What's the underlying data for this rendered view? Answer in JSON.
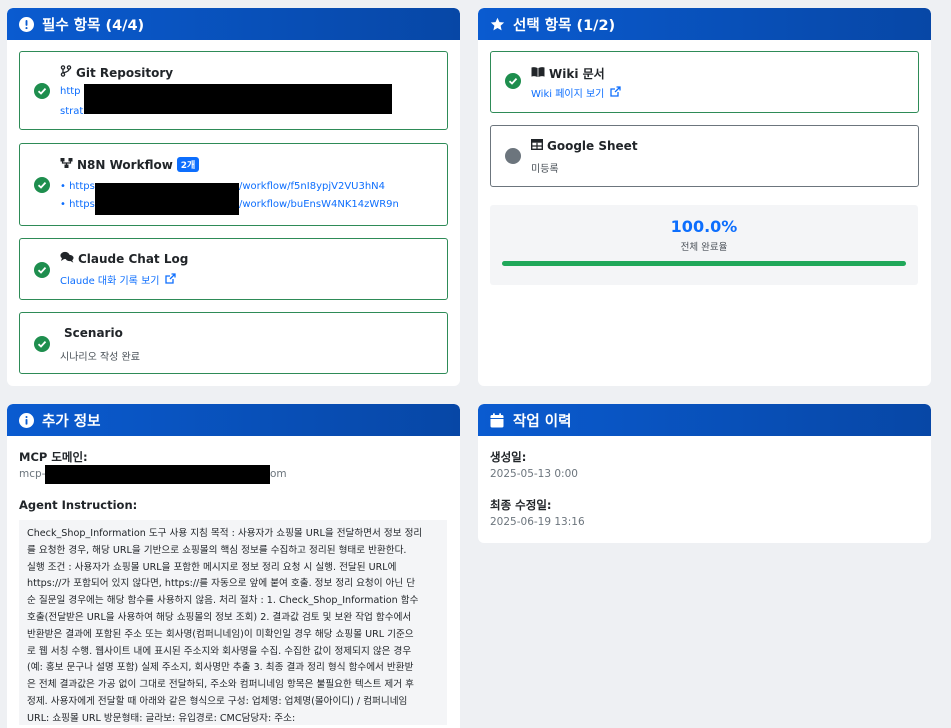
{
  "required": {
    "title": "필수 항목 (4/4)",
    "git": {
      "title": "Git Repository",
      "link_start": "http",
      "link_end": "strat"
    },
    "n8n": {
      "title": "N8N Workflow",
      "badge": "2개",
      "link1_prefix": "• https:",
      "link1_suffix": "/workflow/f5nI8ypjV2VU3hN4",
      "link2_prefix": "• https:",
      "link2_suffix": "/workflow/buEnsW4NK14zWR9n"
    },
    "claude": {
      "title": "Claude Chat Log",
      "link": "Claude 대화 기록 보기"
    },
    "scenario": {
      "title": "Scenario",
      "text": "시나리오 작성 완료"
    }
  },
  "optional": {
    "title": "선택 항목 (1/2)",
    "wiki": {
      "title": "Wiki 문서",
      "link": "Wiki 페이지 보기"
    },
    "sheet": {
      "title": "Google Sheet",
      "text": "미등록"
    },
    "progress": {
      "value_text": "100.0%",
      "value": 1.0,
      "label": "전체 완료율"
    }
  },
  "extra": {
    "title": "추가 정보",
    "mcp_label": "MCP 도메인:",
    "mcp_prefix": "mcp-",
    "mcp_suffix": "om",
    "instruction_label": "Agent Instruction:",
    "instruction_lines": [
      "Check_Shop_Information 도구 사용 지침 목적 : 사용자가 쇼핑몰 URL을 전달하면서 정보 정리",
      "를 요청한 경우, 해당 URL을 기반으로 쇼핑몰의 핵심 정보를 수집하고 정리된 형태로 반환한다.",
      "실행 조건 : 사용자가 쇼핑몰 URL을 포함한 메시지로 정보 정리 요청 시 실행. 전달된 URL에",
      "https://가 포함되어 있지 않다면, https://를 자동으로 앞에 붙여 호출. 정보 정리 요청이 아닌 단",
      "순 질문일 경우에는 해당 함수를 사용하지 않음.  처리 절차 :  1. Check_Shop_Information 함수",
      "호출(전달받은 URL을 사용하여 해당 쇼핑몰의 정보 조회)  2. 결과값 검토 및 보완 작업 함수에서",
      "반환받은 결과에 포함된 주소 또는 회사명(컴퍼니네임)이 미확인일 경우 해당 쇼핑몰 URL 기준으",
      "로 웹 서칭 수행. 웹사이트 내에 표시된 주소지와 회사명을 수집. 수집한 값이 정제되지 않은 경우",
      "(예: 홍보 문구나 설명 포함) 실제 주소지, 회사명만 추출  3. 최종 결과 정리 형식 함수에서 반환받",
      "은 전체 결과값은 가공 없이 그대로 전달하되, 주소와 컴퍼니네임 항목은 불필요한 텍스트 제거 후",
      "정제. 사용자에게 전달할 때 아래와 같은 형식으로 구성: 업체명: 업체명(몰아이디) / 컴퍼니네임",
      "URL: 쇼핑몰 URL 방문형태:  글라보:  유입경로:  CMC담당자:  주소:"
    ]
  },
  "history": {
    "title": "작업 이력",
    "created_label": "생성일:",
    "created_value": "2025-05-13 0:00",
    "modified_label": "최종 수정일:",
    "modified_value": "2025-06-19 13:16"
  }
}
